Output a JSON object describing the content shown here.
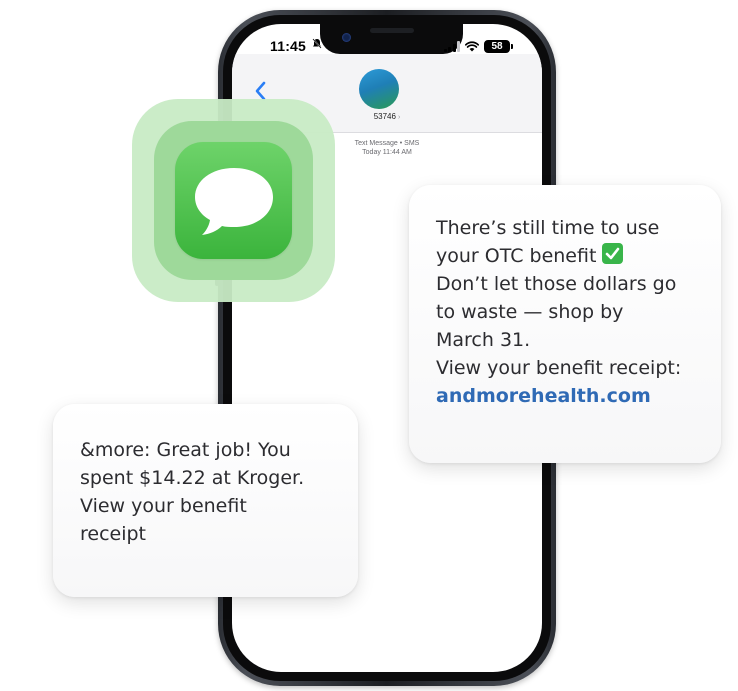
{
  "status_bar": {
    "time": "11:45",
    "battery": "58"
  },
  "thread": {
    "contact_name": "53746",
    "message_type": "Text Message • SMS",
    "timestamp": "Today 11:44 AM"
  },
  "icons": {
    "app": "messages-app-icon",
    "check": "check-mark-emoji-icon",
    "back": "chevron-left-icon"
  },
  "colors": {
    "messages_green": "#3bb43c",
    "link_blue": "#2f6ab5",
    "check_green": "#39b54a"
  },
  "card_right": {
    "lines": [
      "There’s still time to use",
      "your OTC benefit",
      "Don’t let those dollars go",
      "to waste — shop by",
      "March 31.",
      "View your benefit receipt:"
    ],
    "link": "andmorehealth.com"
  },
  "card_left": {
    "lines": [
      "&more: Great job! You",
      "spent $14.22 at Kroger.",
      "View your benefit",
      "receipt"
    ]
  }
}
